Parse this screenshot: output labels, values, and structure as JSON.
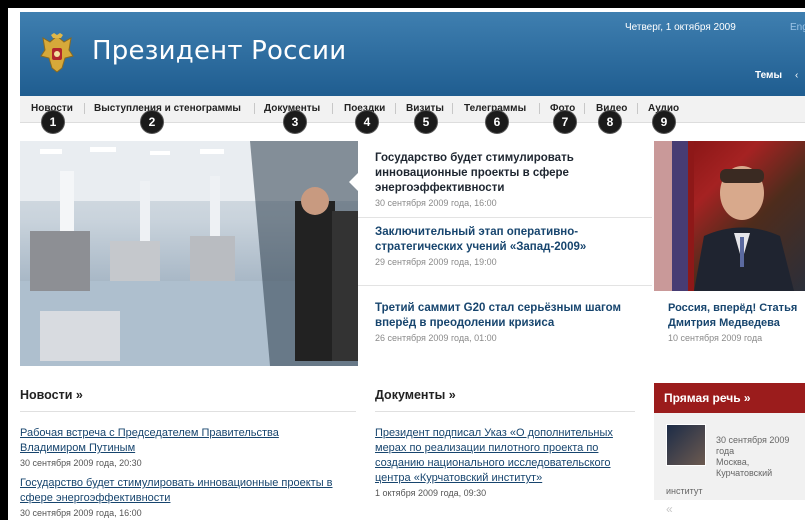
{
  "header": {
    "site_title": "Президент России",
    "date": "Четверг, 1 октября 2009",
    "lang": "Eng",
    "topics": "Темы",
    "topics_separator": "‹"
  },
  "nav": {
    "items": [
      {
        "label": "Новости",
        "num": "1"
      },
      {
        "label": "Выступления и стенограммы",
        "num": "2"
      },
      {
        "label": "Документы",
        "num": "3"
      },
      {
        "label": "Поездки",
        "num": "4"
      },
      {
        "label": "Визиты",
        "num": "5"
      },
      {
        "label": "Телеграммы",
        "num": "6"
      },
      {
        "label": "Фото",
        "num": "7"
      },
      {
        "label": "Видео",
        "num": "8"
      },
      {
        "label": "Аудио",
        "num": "9"
      }
    ]
  },
  "feature": {
    "headlines": [
      {
        "title": "Государство будет стимулировать инновационные проекты в сфере энергоэффективности",
        "date": "30 сентября 2009 года, 16:00"
      },
      {
        "title": "Заключительный этап оперативно-стратегических учений «Запад-2009»",
        "date": "29 сентября 2009 года, 19:00"
      },
      {
        "title": "Третий саммит G20 стал серьёзным шагом вперёд в преодолении кризиса",
        "date": "26 сентября 2009 года, 01:00"
      }
    ],
    "side": {
      "title": "Россия, вперёд! Статья Дмитрия Медведева",
      "date": "10 сентября 2009 года"
    }
  },
  "news": {
    "title": "Новости »",
    "items": [
      {
        "title": "Рабочая встреча с Председателем Правительства Владимиром Путиным",
        "date": "30 сентября 2009 года, 20:30"
      },
      {
        "title": "Государство будет стимулировать инновационные проекты в сфере энергоэффективности",
        "date": "30 сентября 2009 года, 16:00"
      }
    ]
  },
  "documents": {
    "title": "Документы »",
    "items": [
      {
        "title": "Президент подписал Указ «О дополнительных мерах по реализации пилотного проекта по созданию национального исследовательского центра «Курчатовский институт»",
        "date": "1 октября 2009 года, 09:30"
      }
    ]
  },
  "speech": {
    "title": "Прямая речь »",
    "date_text": "30 сентября 2009 года",
    "place": "Москва, Курчатовский",
    "place2": "институт",
    "quote": "«"
  }
}
